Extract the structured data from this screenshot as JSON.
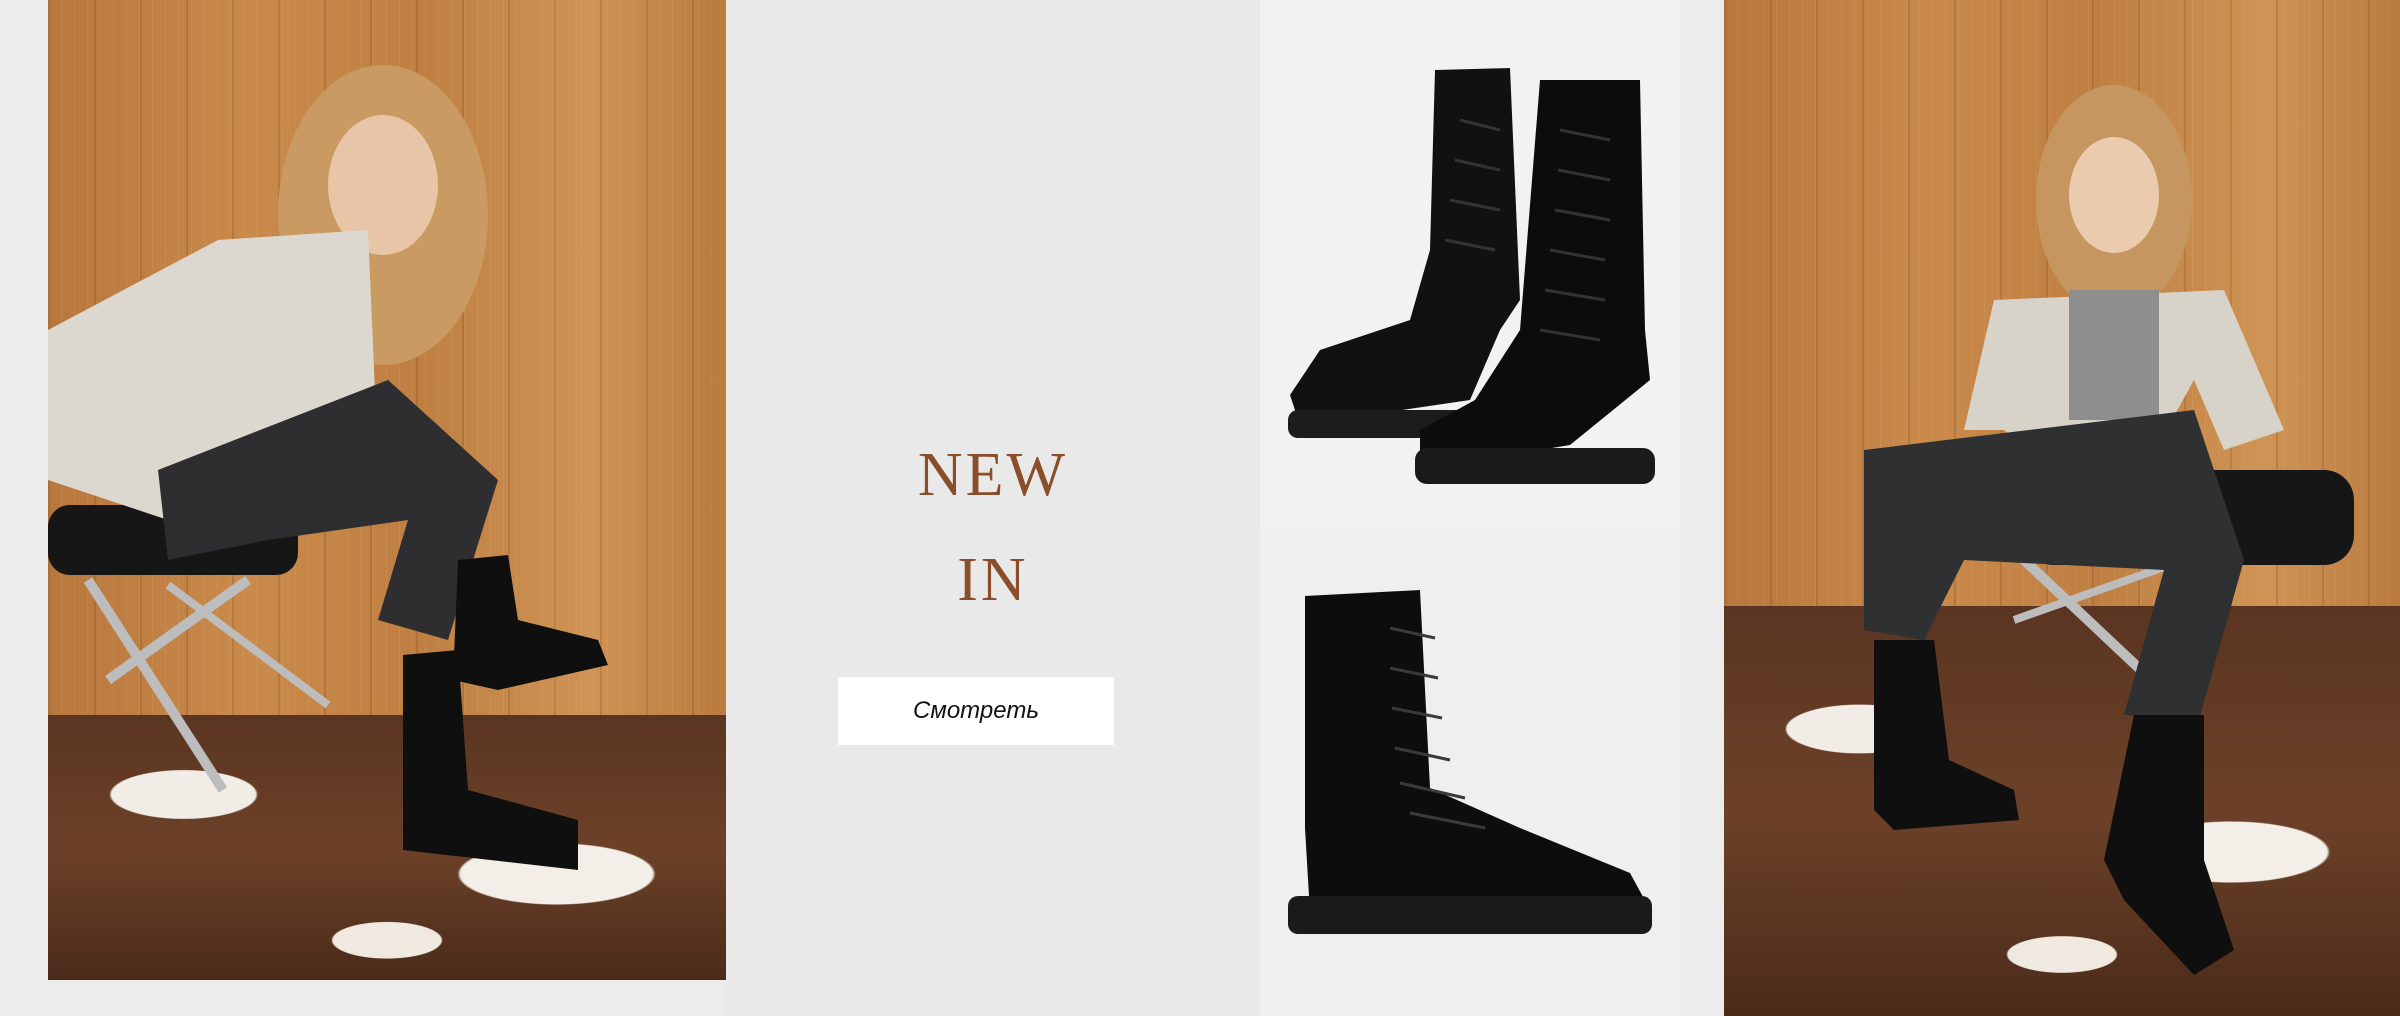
{
  "banner": {
    "headline_line1": "NEW",
    "headline_line2": "IN",
    "cta_label": "Смотреть"
  },
  "colors": {
    "background": "#ececec",
    "headline": "#8a4f2a",
    "button_bg": "#ffffff",
    "button_text": "#111111"
  },
  "images": {
    "left_photo": "model-seated-in-boots-photo",
    "top_product": "pair-of-black-lace-up-boots",
    "bottom_product": "single-black-lace-up-boot",
    "right_photo": "model-seated-in-boots-photo-2"
  }
}
